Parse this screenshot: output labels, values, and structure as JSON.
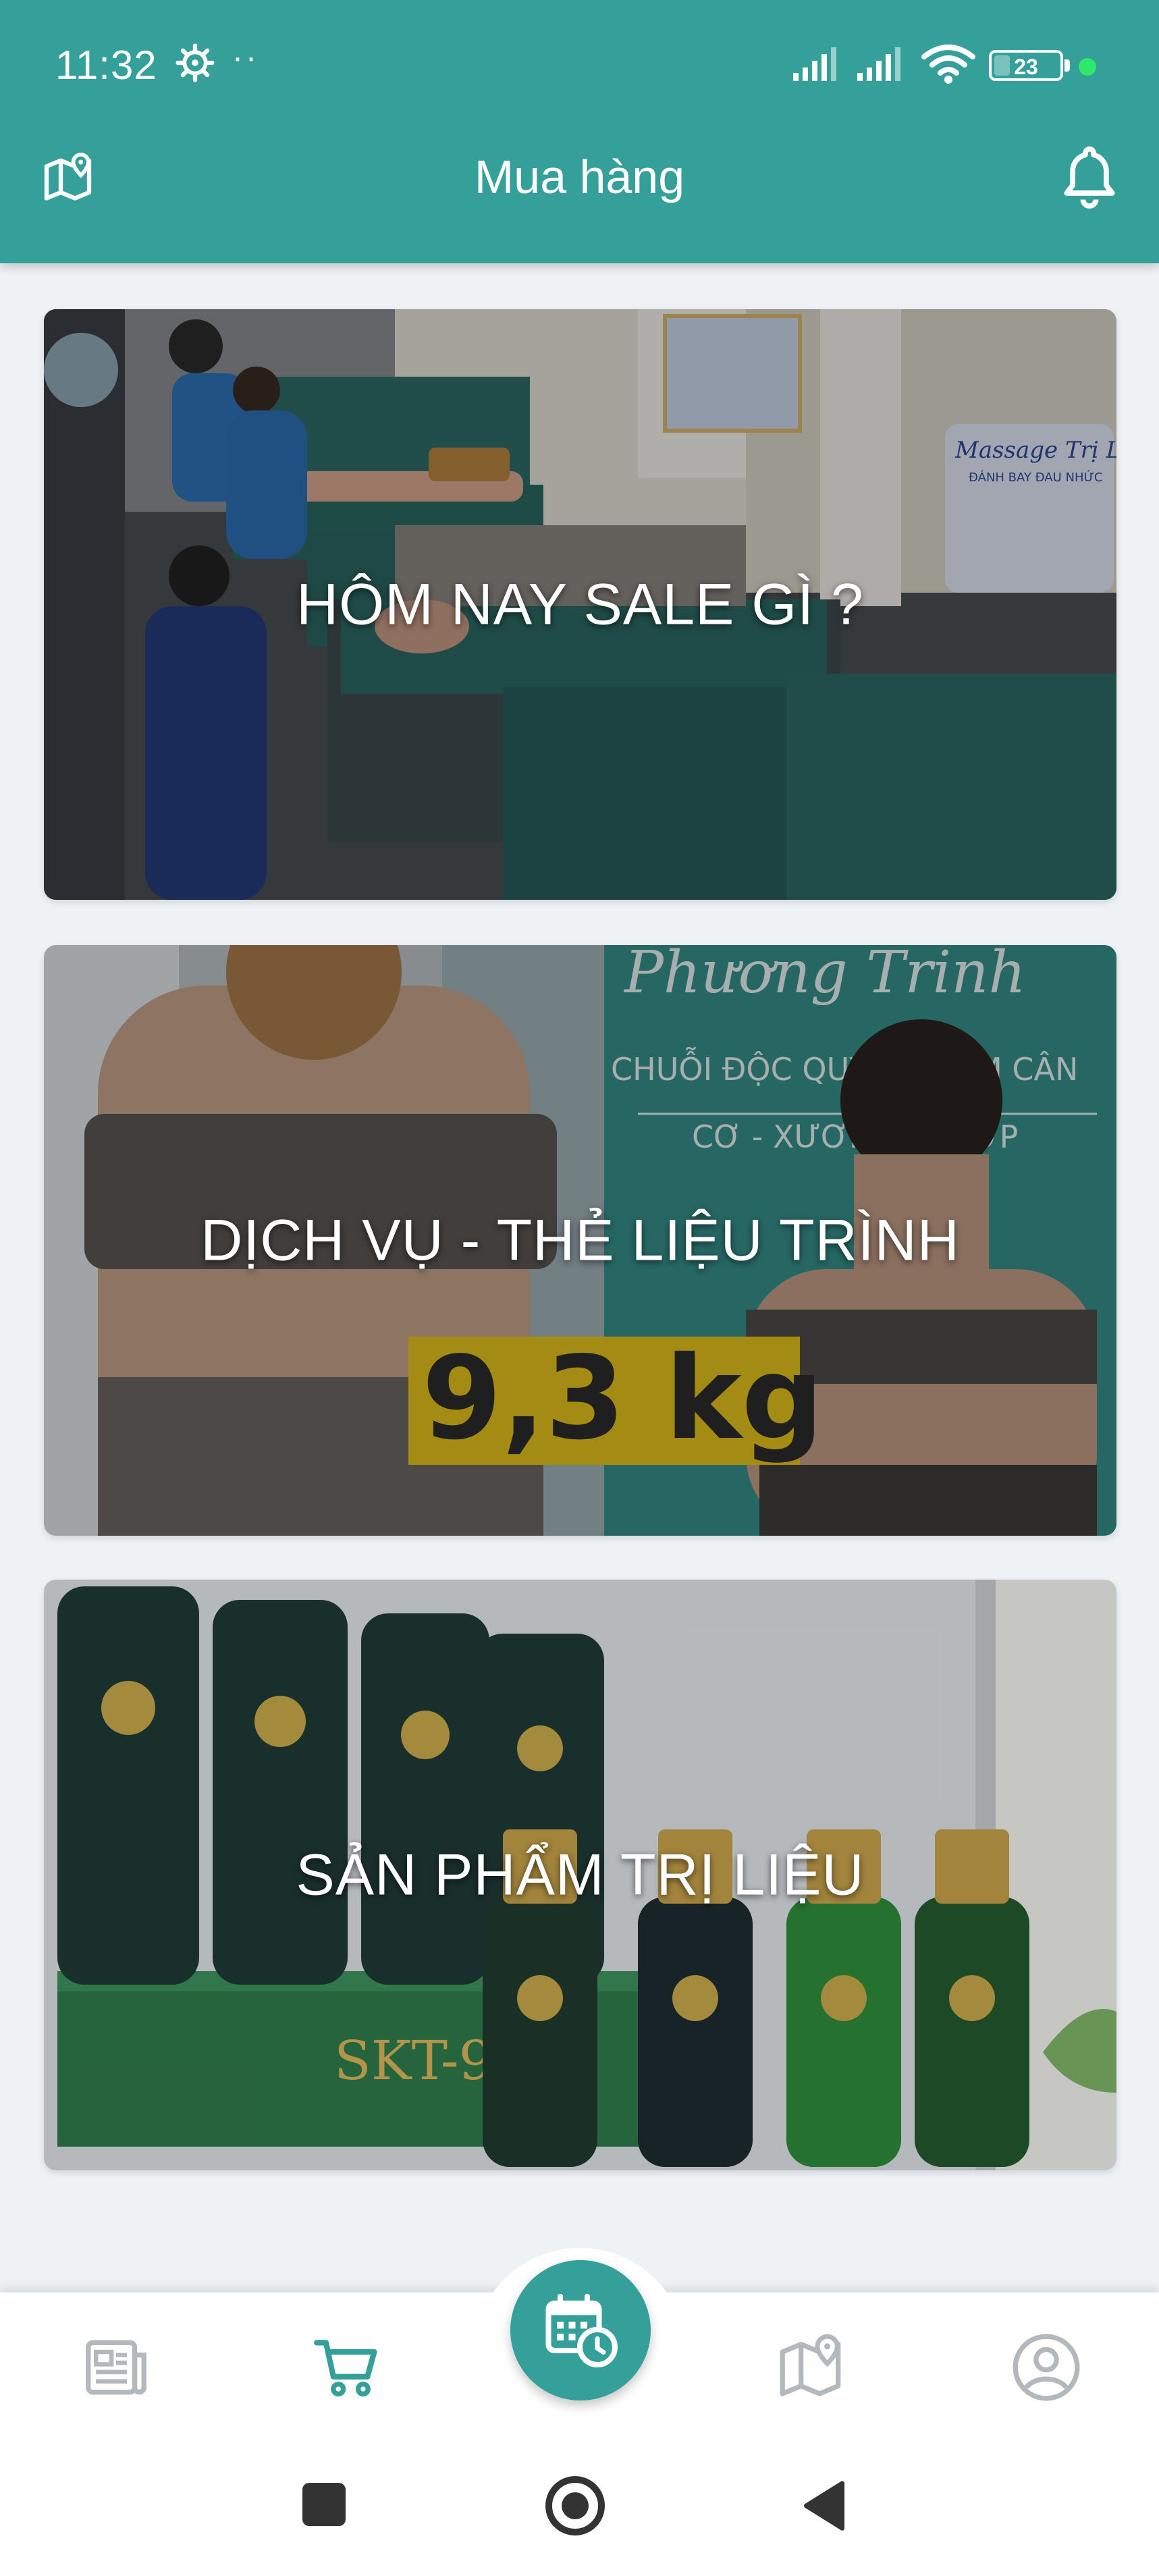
{
  "status_bar": {
    "time": "11:32",
    "dots": "··",
    "battery_level": "23"
  },
  "app_bar": {
    "title": "Mua hàng"
  },
  "cards": [
    {
      "label": "HÔM NAY SALE GÌ ?"
    },
    {
      "label": "DỊCH VỤ - THẺ LIỆU TRÌNH"
    },
    {
      "label": "SẢN PHẨM TRỊ LIỆU"
    }
  ],
  "card_image_text": {
    "massage_sign": "Massage Trị Liệu",
    "massage_sub": "ĐÁNH BAY ĐAU NHỨC",
    "brand_sign": "Phương Trinh",
    "brand_line1": "CHUỖI ĐỘC QUYỀN GIẢM CÂN",
    "brand_line2": "CƠ - XƯƠNG - KHỚP",
    "weight": "9,3 kg",
    "product": "SKT-9"
  },
  "bottom_nav": {
    "items": [
      "news-icon",
      "cart-icon",
      "calendar-clock-icon",
      "map-icon",
      "profile-icon"
    ],
    "active": "cart-icon"
  },
  "colors": {
    "primary": "#35a099",
    "inactive_icon": "#b3b8bd",
    "active_icon": "#35a099"
  }
}
